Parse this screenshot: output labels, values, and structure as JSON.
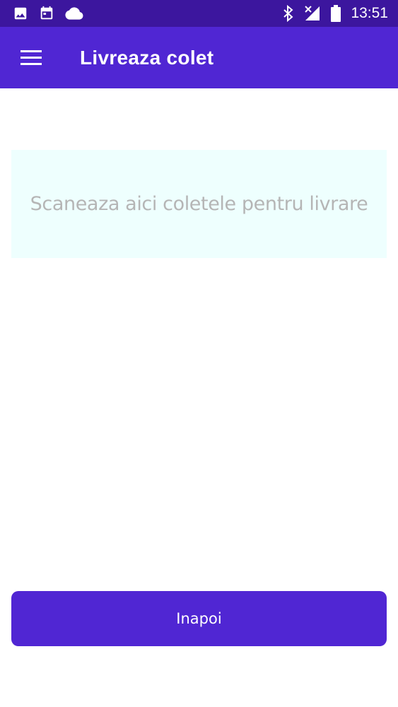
{
  "status_bar": {
    "time": "13:51",
    "icons_left": [
      "image-icon",
      "calendar-icon",
      "cloud-icon"
    ],
    "icons_right": [
      "bluetooth-icon",
      "no-signal-icon",
      "battery-icon"
    ]
  },
  "app_bar": {
    "title": "Livreaza colet",
    "menu_icon": "hamburger-menu-icon"
  },
  "scan_field": {
    "placeholder": "Scaneaza aici coletele pentru livrare",
    "value": ""
  },
  "actions": {
    "back_label": "Inapoi"
  },
  "colors": {
    "status_bar": "#3c169e",
    "primary": "#5026d3",
    "scan_field_bg": "#eefffe",
    "placeholder_text": "#b5b5b5"
  }
}
